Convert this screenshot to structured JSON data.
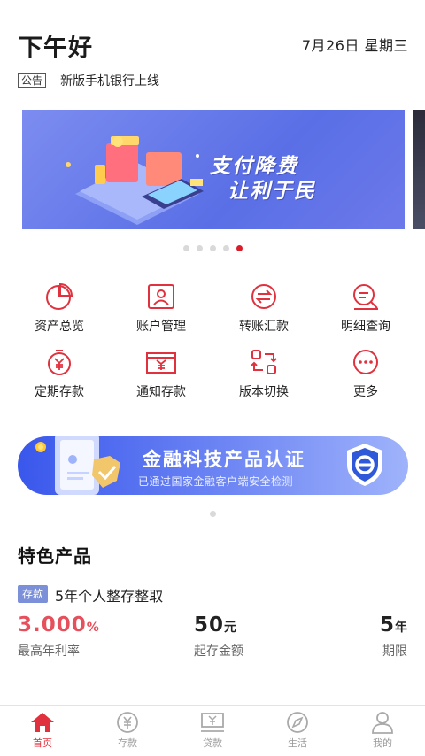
{
  "header": {
    "greeting": "下午好",
    "date": "7月26日 星期三",
    "notice_tag": "公告",
    "notice_text": "新版手机银行上线"
  },
  "banner": {
    "line1": "支付降费",
    "line2": "让利于民",
    "dot_count": 5,
    "active_dot": 5
  },
  "quick_menu": [
    {
      "label": "资产总览",
      "icon": "pie-chart-icon"
    },
    {
      "label": "账户管理",
      "icon": "account-card-icon"
    },
    {
      "label": "转账汇款",
      "icon": "transfer-icon"
    },
    {
      "label": "明细查询",
      "icon": "detail-search-icon"
    },
    {
      "label": "定期存款",
      "icon": "fixed-deposit-icon"
    },
    {
      "label": "通知存款",
      "icon": "notice-deposit-icon"
    },
    {
      "label": "版本切换",
      "icon": "version-switch-icon"
    },
    {
      "label": "更多",
      "icon": "more-icon"
    }
  ],
  "promo": {
    "title": "金融科技产品认证",
    "subtitle": "已通过国家金融客户端安全检测"
  },
  "featured": {
    "section_title": "特色产品",
    "tag": "存款",
    "name": "5年个人整存整取",
    "rate_value": "3.000",
    "rate_unit": "%",
    "rate_label": "最高年利率",
    "amount_value": "50",
    "amount_unit": "元",
    "amount_label": "起存金额",
    "term_value": "5",
    "term_unit": "年",
    "term_label": "期限"
  },
  "tabbar": [
    {
      "label": "首页",
      "icon": "home-icon",
      "active": true
    },
    {
      "label": "存款",
      "icon": "yuan-coin-icon",
      "active": false
    },
    {
      "label": "贷款",
      "icon": "loan-icon",
      "active": false
    },
    {
      "label": "生活",
      "icon": "compass-icon",
      "active": false
    },
    {
      "label": "我的",
      "icon": "user-icon",
      "active": false
    }
  ],
  "colors": {
    "brand_red": "#e0323e",
    "active_dot": "#d81e2b",
    "rate_red": "#e5505c",
    "banner_blue": "#5a6fe6",
    "promo_blue": "#3957ec"
  }
}
